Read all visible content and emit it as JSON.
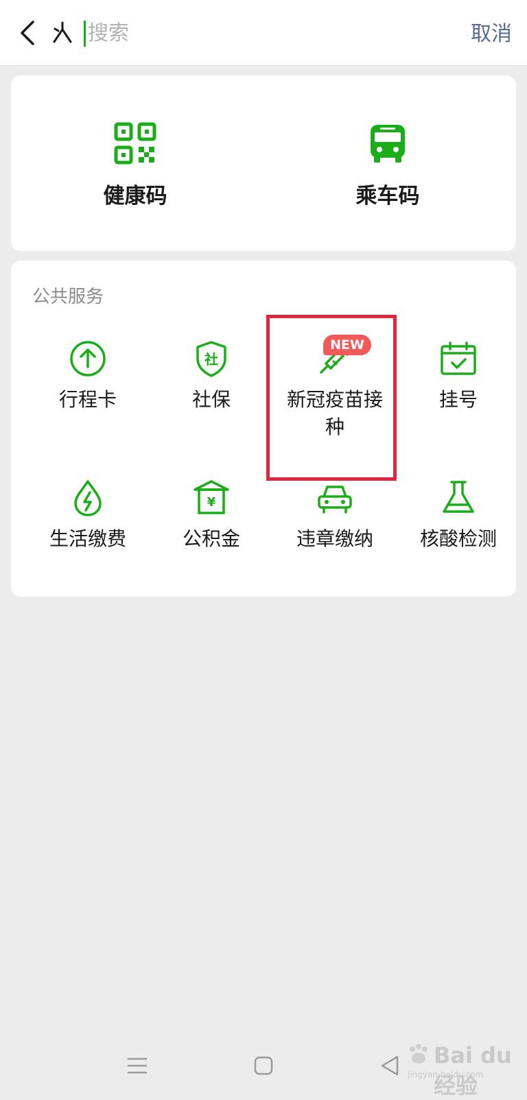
{
  "search": {
    "placeholder": "搜索",
    "cancel_label": "取消"
  },
  "quick_access": [
    {
      "label": "健康码",
      "icon": "qr-code-icon"
    },
    {
      "label": "乘车码",
      "icon": "bus-icon"
    }
  ],
  "public_services": {
    "title": "公共服务",
    "items": [
      {
        "label": "行程卡",
        "icon": "arrow-up-circle-icon"
      },
      {
        "label": "社保",
        "icon": "shield-icon",
        "icon_text": "社"
      },
      {
        "label": "新冠疫苗接种",
        "icon": "syringe-icon",
        "badge": "NEW",
        "highlighted": true
      },
      {
        "label": "挂号",
        "icon": "calendar-check-icon"
      },
      {
        "label": "生活缴费",
        "icon": "droplet-bolt-icon"
      },
      {
        "label": "公积金",
        "icon": "house-yen-icon",
        "icon_text": "¥"
      },
      {
        "label": "违章缴纳",
        "icon": "car-icon"
      },
      {
        "label": "核酸检测",
        "icon": "flask-icon"
      }
    ]
  },
  "watermark": {
    "brand": "Bai du 经验",
    "url": "jingyan.baidu.com"
  },
  "colors": {
    "accent_green": "#1aad19",
    "cancel_blue": "#576b95",
    "highlight_red": "#e0273f",
    "badge_red": "#f25a5a",
    "background": "#ececec"
  }
}
